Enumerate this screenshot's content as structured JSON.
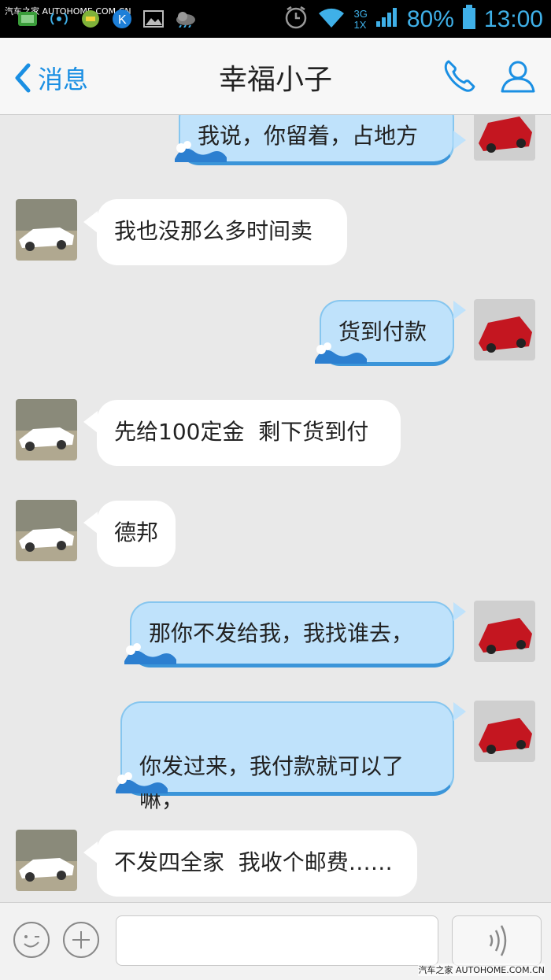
{
  "watermark_top": "汽车之家 AUTOHOME.COM.CN",
  "watermark_bottom": "汽车之家 AUTOHOME.COM.CN",
  "status": {
    "network": "3G\n1X",
    "battery": "80%",
    "time": "13:00"
  },
  "header": {
    "back_label": "消息",
    "title": "幸福小子"
  },
  "messages": [
    {
      "side": "out",
      "text": "我说，你留着，占地方"
    },
    {
      "side": "in",
      "text": "我也没那么多时间卖"
    },
    {
      "side": "out",
      "text": "货到付款"
    },
    {
      "side": "in",
      "text": "先给100定金  剩下货到付"
    },
    {
      "side": "in",
      "text": "德邦"
    },
    {
      "side": "out",
      "text": "那你不发给我，我找谁去，"
    },
    {
      "side": "out",
      "text": "你发过来，我付款就可以了\n嘛，"
    },
    {
      "side": "in",
      "text": "不发四全家  我收个邮费……"
    }
  ],
  "colors": {
    "accent": "#1a8fe3",
    "out_bubble": "#bfe2fb",
    "in_bubble": "#ffffff"
  },
  "icons": [
    "phone-icon",
    "contact-icon",
    "emoji-icon",
    "plus-icon",
    "voice-icon"
  ]
}
